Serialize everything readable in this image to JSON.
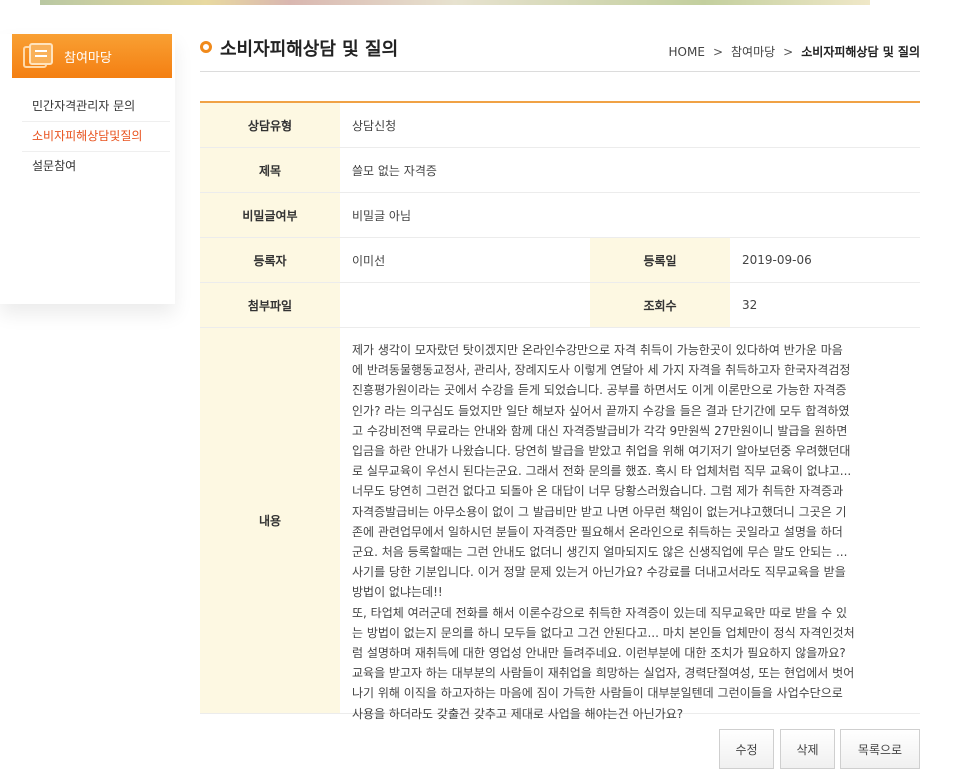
{
  "sidebar": {
    "title": "참여마당",
    "items": [
      {
        "label": "민간자격관리자 문의",
        "active": false
      },
      {
        "label": "소비자피해상담및질의",
        "active": true
      },
      {
        "label": "설문참여",
        "active": false
      }
    ]
  },
  "header": {
    "title": "소비자피해상담 및 질의",
    "breadcrumb": [
      "HOME",
      "참여마당",
      "소비자피해상담 및 질의"
    ]
  },
  "detail": {
    "type_label": "상담유형",
    "type_value": "상담신청",
    "subject_label": "제목",
    "subject_value": "쓸모 없는 자격증",
    "secret_label": "비밀글여부",
    "secret_value": "비밀글 아님",
    "author_label": "등록자",
    "author_value": "이미선",
    "date_label": "등록일",
    "date_value": "2019-09-06",
    "attach_label": "첨부파일",
    "attach_value": "",
    "views_label": "조회수",
    "views_value": "32",
    "content_label": "내용",
    "content_lines": [
      "제가 생각이 모자랐던 탓이겠지만 온라인수강만으로 자격 취득이 가능한곳이 있다하여 반가운 마음",
      "에 반려동물행동교정사, 관리사, 장례지도사 이렇게 연달아 세 가지 자격을 취득하고자 한국자격검정",
      "진흥평가원이라는 곳에서 수강을 듣게 되었습니다. 공부를 하면서도 이게 이론만으로 가능한 자격증",
      "인가? 라는 의구심도 들었지만 일단 해보자 싶어서 끝까지 수강을 들은 결과 단기간에 모두 합격하였",
      "고 수강비전액 무료라는 안내와 함께 대신 자격증발급비가 각각 9만원씩 27만원이니 발급을 원하면",
      "입금을 하란 안내가 나왔습니다. 당연히 발급을 받았고 취업을 위해 여기저기 알아보던중 우려했던대",
      "로 실무교육이 우선시 된다는군요. 그래서 전화 문의를 했죠. 혹시 타 업체처럼 직무 교육이 없냐고...",
      "너무도 당연히 그런건 없다고 되돌아 온 대답이 너무 당황스러웠습니다. 그럼 제가 취득한 자격증과",
      "자격증발급비는 아무소용이 없이 그 발급비만 받고 나면 아무런 책임이 없는거냐고했더니 그곳은 기",
      "존에 관련업무에서 일하시던 분들이 자격증만 필요해서 온라인으로 취득하는 곳일라고 설명을 하더",
      "군요. 처음 등록할때는 그런 안내도 없더니 생긴지 얼마되지도 않은 신생직업에 무슨 말도 안되는 ...",
      "사기를 당한 기분입니다. 이거 정말 문제 있는거 아닌가요? 수강료를 더내고서라도 직무교육을 받을",
      "방법이 없냐는데!!",
      "또, 타업체 여러군데 전화를 해서 이론수강으로 취득한 자격증이 있는데 직무교육만 따로 받을 수 있",
      "는 방법이 없는지 문의를 하니 모두들 없다고 그건 안된다고... 마치 본인들 업체만이 정식 자격인것처",
      "럼 설명하며 재취득에 대한 영업성 안내만 들려주네요. 이런부분에 대한 조치가 필요하지 않을까요?",
      "교육을 받고자 하는 대부분의 사람들이 재취업을 희망하는 실업자, 경력단절여성, 또는 현업에서 벗어",
      "나기 위해 이직을 하고자하는 마음에 짐이 가득한 사람들이 대부분일텐데 그런이들을 사업수단으로",
      "사용을 하더라도 갖출건 갖추고 제대로 사업을 해야는건 아닌가요?"
    ]
  },
  "buttons": {
    "edit": "수정",
    "delete": "삭제",
    "list": "목록으로"
  },
  "colors": {
    "accent": "#f47f12",
    "active_menu": "#e8521e",
    "label_bg": "#fdf8e2"
  }
}
